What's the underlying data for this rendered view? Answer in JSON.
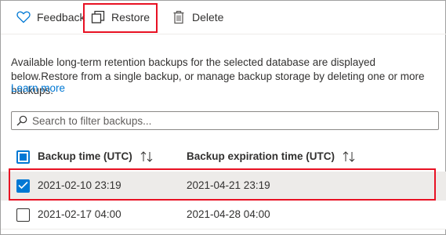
{
  "toolbar": {
    "feedback_label": "Feedback",
    "restore_label": "Restore",
    "delete_label": "Delete"
  },
  "description": "Available long-term retention backups for the selected database are displayed below.Restore from a single backup, or manage backup storage by deleting one or more backups.",
  "learn_more": "Learn more",
  "search": {
    "placeholder": "Search to filter backups..."
  },
  "table": {
    "headers": [
      "Backup time (UTC)",
      "Backup expiration time (UTC)"
    ],
    "rows": [
      {
        "backup_time": "2021-02-10 23:19",
        "expiration_time": "2021-04-21 23:19",
        "selected": true
      },
      {
        "backup_time": "2021-02-17 04:00",
        "expiration_time": "2021-04-28 04:00",
        "selected": false
      }
    ]
  },
  "colors": {
    "accent": "#0078d4",
    "highlight": "#e81123",
    "selected_row": "#edebe9"
  },
  "icons": [
    "heart-icon",
    "restore-icon",
    "trash-icon",
    "search-icon",
    "sort-icon",
    "checkmark-icon"
  ]
}
